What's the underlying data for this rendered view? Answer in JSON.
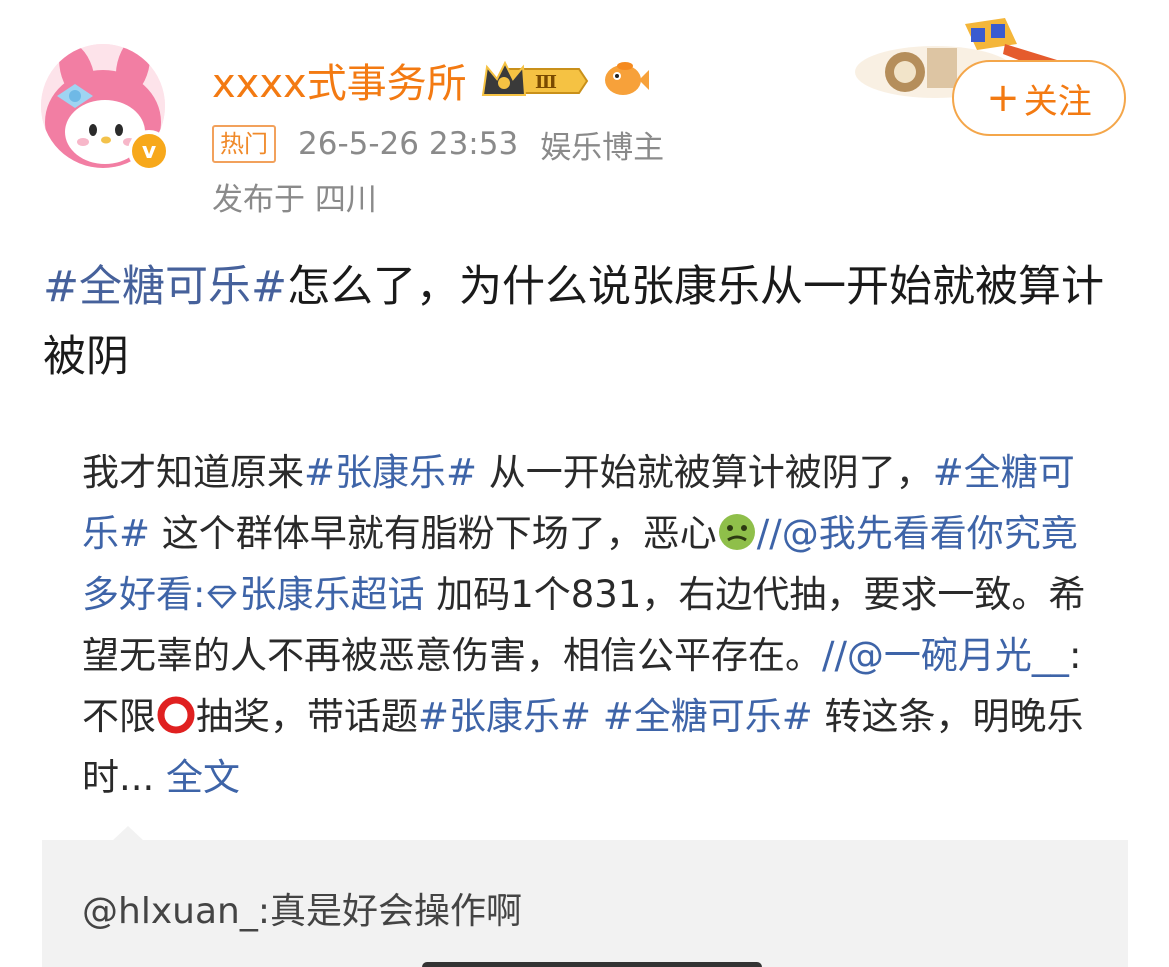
{
  "header": {
    "username": "xxxx式事务所",
    "level_badge": "Ⅲ",
    "verified_mark": "v",
    "hot_tag": "热门",
    "timestamp": "26-5-26 23:53",
    "role": "娱乐博主",
    "location": "发布于 四川",
    "follow_plus": "+",
    "follow_label": "关注",
    "icons": [
      "avatar-my-melody",
      "verified-icon",
      "crown-icon",
      "fish-icon",
      "award-deco-icon"
    ]
  },
  "post": {
    "topic": "#全糖可乐#",
    "text": "怎么了，为什么说张康乐从一开始就被算计被阴"
  },
  "quoted": {
    "s1": "我才知道原来",
    "l1": "#张康乐#",
    "s2": " 从一开始就被算计被阴了，",
    "l2": "#全糖可乐#",
    "s3": " 这个群体早就有脂粉下场了，恶心",
    "l3": "//@我先看看你究竟多好看:",
    "l4": "张康乐超话",
    "s4": " 加码1个831，右边代抽，要求一致。希望无辜的人不再被恶意伤害，相信公平存在。",
    "l5": "//@一碗月光__",
    "s5": ":不限",
    "s6": "抽奖，带话题",
    "l6": "#张康乐#",
    "s7": " ",
    "l7": "#全糖可乐#",
    "s8": " 转这条，明晚乐时... ",
    "l8": "全文",
    "reply": "@hlxuan_:真是好会操作啊",
    "colors": {
      "link": "#3e64a8",
      "text": "#2a2a2a",
      "reply_bg": "#f2f2f2"
    }
  },
  "colors": {
    "accent": "#f37a12",
    "topic": "#46619b",
    "meta": "#8a8a8a"
  }
}
